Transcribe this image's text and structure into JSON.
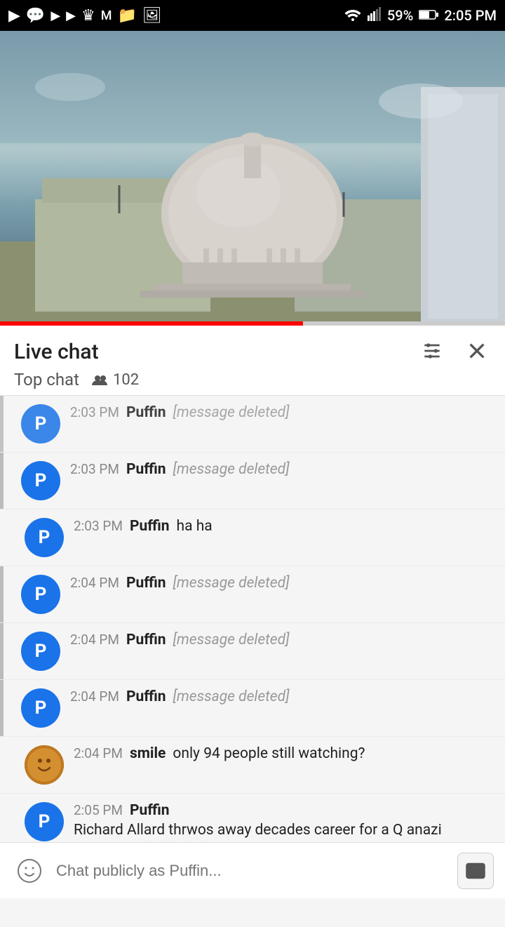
{
  "statusBar": {
    "time": "2:05 PM",
    "battery": "59%",
    "leftIcons": [
      "youtube-tv-icon",
      "chat-icon",
      "youtube-icon",
      "youtube-icon2",
      "crown-icon",
      "mastodon-icon",
      "folder-icon",
      "image-icon"
    ]
  },
  "video": {
    "alt": "US Capitol building live stream"
  },
  "liveChat": {
    "title": "Live chat",
    "topChatLabel": "Top chat",
    "viewerCount": "102"
  },
  "messages": [
    {
      "avatarLetter": "P",
      "time": "2:03 PM",
      "author": "Puffin",
      "text": "[message deleted]",
      "deleted": true
    },
    {
      "avatarLetter": "P",
      "time": "2:03 PM",
      "author": "Puffin",
      "text": "[message deleted]",
      "deleted": true
    },
    {
      "avatarLetter": "P",
      "time": "2:03 PM",
      "author": "Puffin",
      "text": "ha ha",
      "deleted": false
    },
    {
      "avatarLetter": "P",
      "time": "2:04 PM",
      "author": "Puffin",
      "text": "[message deleted]",
      "deleted": true
    },
    {
      "avatarLetter": "P",
      "time": "2:04 PM",
      "author": "Puffin",
      "text": "[message deleted]",
      "deleted": true
    },
    {
      "avatarLetter": "P",
      "time": "2:04 PM",
      "author": "Puffin",
      "text": "[message deleted]",
      "deleted": true
    },
    {
      "avatarLetter": "smile",
      "time": "2:04 PM",
      "author": "smile",
      "text": "only 94 people still watching?",
      "deleted": false
    },
    {
      "avatarLetter": "P",
      "time": "2:05 PM",
      "author": "Puffin",
      "text": "Richard Allard thrwos away decades career for a Q anazi chatroom 😀😀😀😀",
      "deleted": false
    }
  ],
  "inputBar": {
    "placeholder": "Chat publicly as Puffin..."
  },
  "colors": {
    "accent": "#ff0000",
    "deletedBar": "#bbbbbb",
    "avatarBlue": "#1a73e8"
  }
}
